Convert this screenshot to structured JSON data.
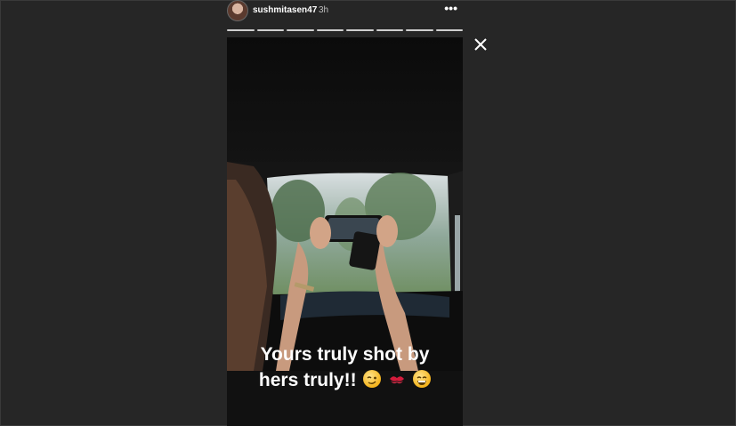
{
  "header": {
    "username": "sushmitasen47",
    "timestamp": "3h",
    "more_icon": "more-horizontal-icon"
  },
  "progress": {
    "segments": 8,
    "current_segment": 8
  },
  "story": {
    "caption_line1": "Yours truly shot by",
    "caption_line2": "hers truly!!",
    "emojis": [
      "winking-face",
      "kiss-mark",
      "grinning-face"
    ]
  },
  "colors": {
    "background": "#262626",
    "text": "#ffffff",
    "progress": "#cfcfcf"
  }
}
